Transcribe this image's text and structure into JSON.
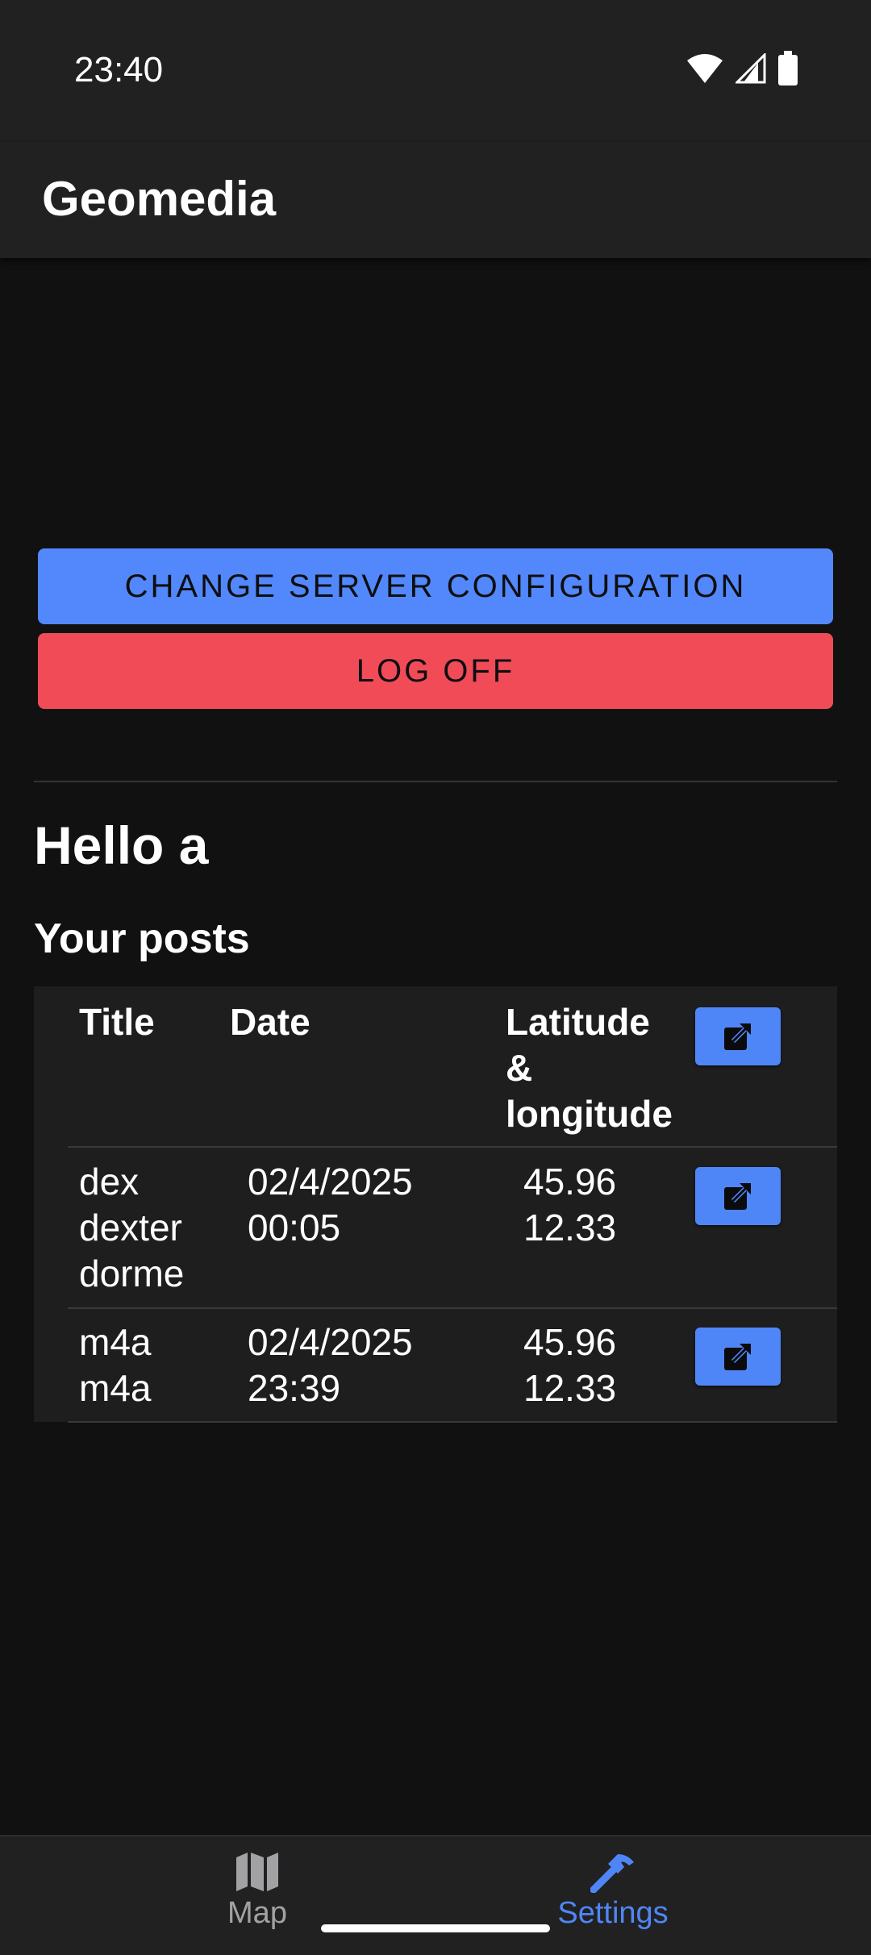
{
  "status_bar": {
    "time": "23:40",
    "icons": [
      "wifi-icon",
      "signal-icon",
      "battery-icon"
    ]
  },
  "app_bar": {
    "title": "Geomedia"
  },
  "actions": {
    "change_server_label": "CHANGE SERVER CONFIGURATION",
    "log_off_label": "LOG OFF"
  },
  "greeting": "Hello a",
  "posts": {
    "heading": "Your posts",
    "columns": {
      "title": "Title",
      "date": "Date",
      "lat_long": "Latitude\n&\nlongitude"
    },
    "rows": [
      {
        "title": "dex\ndexter\ndorme",
        "date": "02/4/2025\n00:05",
        "coords": "45.96\n12.33"
      },
      {
        "title": "m4a\nm4a",
        "date": "02/4/2025\n23:39",
        "coords": "45.96\n12.33"
      }
    ]
  },
  "bottom_nav": {
    "items": [
      {
        "label": "Map",
        "icon": "map-icon",
        "active": false
      },
      {
        "label": "Settings",
        "icon": "hammer-icon",
        "active": true
      }
    ]
  },
  "colors": {
    "background": "#111112",
    "surface": "#212122",
    "primary": "#5288fb",
    "danger": "#f14b58",
    "nav_inactive": "#a2a2a5"
  }
}
